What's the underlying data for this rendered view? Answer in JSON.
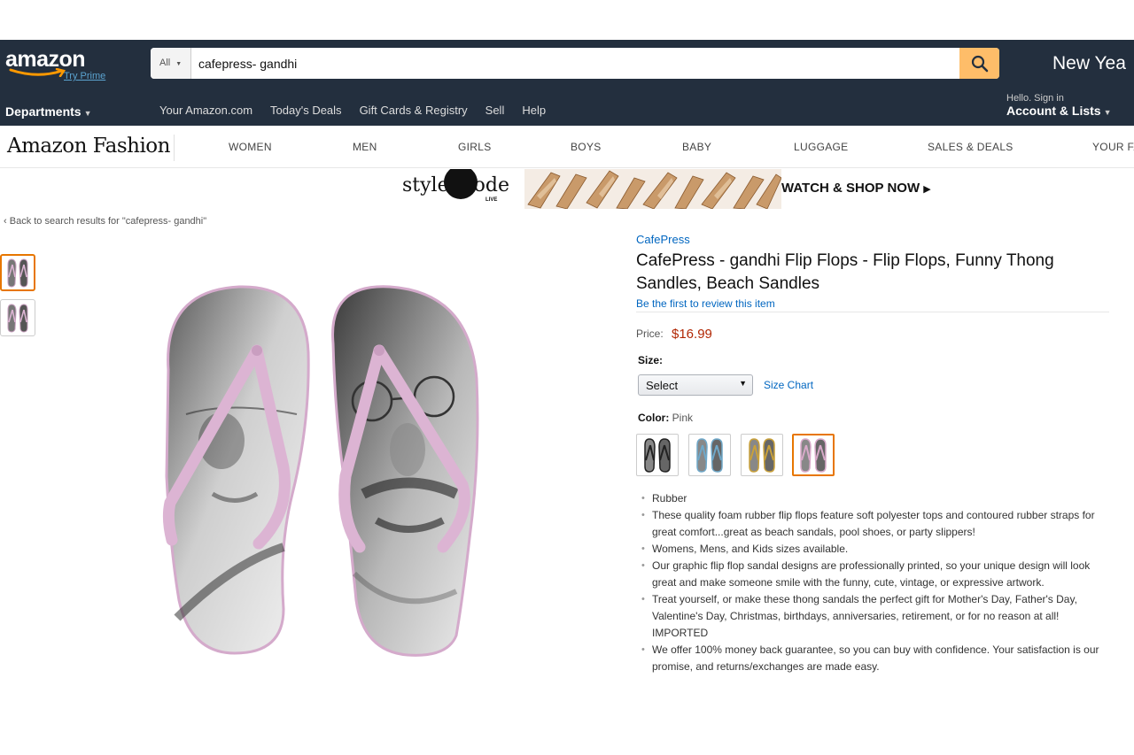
{
  "header": {
    "logo_text": "amazon",
    "logo_prime": "Try Prime",
    "search_scope": "All",
    "search_value": "cafepress- gandhi",
    "promo_text": "New Yea",
    "departments_label": "Departments",
    "nav_links": [
      "Your Amazon.com",
      "Today's Deals",
      "Gift Cards & Registry",
      "Sell",
      "Help"
    ],
    "account_hello": "Hello. Sign in",
    "account_main": "Account & Lists"
  },
  "fashion_nav": {
    "logo": "Amazon Fashion",
    "links": [
      "WOMEN",
      "MEN",
      "GIRLS",
      "BOYS",
      "BABY",
      "LUGGAGE",
      "SALES & DEALS",
      "YOUR FA"
    ]
  },
  "banner": {
    "logo_left": "style",
    "logo_right": "ode",
    "logo_live": "LIVE",
    "cta": "WATCH & SHOP NOW"
  },
  "back_link": "Back to search results for \"cafepress- gandhi\"",
  "product": {
    "brand": "CafePress",
    "title": "CafePress - gandhi Flip Flops - Flip Flops, Funny Thong Sandles, Beach Sandles",
    "review_link": "Be the first to review this item",
    "price_label": "Price:",
    "price": "$16.99",
    "size_label": "Size:",
    "size_selected": "Select",
    "size_chart": "Size Chart",
    "color_label": "Color:",
    "color_value": "Pink",
    "swatches": [
      {
        "color": "#222222",
        "name": "black"
      },
      {
        "color": "#6fa8c9",
        "name": "blue"
      },
      {
        "color": "#c9a13a",
        "name": "gold"
      },
      {
        "color": "#d8a9c9",
        "name": "pink"
      }
    ],
    "strap_color": "#dcb4d3",
    "bullets": [
      "Rubber",
      "These quality foam rubber flip flops feature soft polyester tops and contoured rubber straps for great comfort...great as beach sandals, pool shoes, or party slippers!",
      "Womens, Mens, and Kids sizes available.",
      "Our graphic flip flop sandal designs are professionally printed, so your unique design will look great and make someone smile with the funny, cute, vintage, or expressive artwork.",
      "Treat yourself, or make these thong sandals the perfect gift for Mother's Day, Father's Day, Valentine's Day, Christmas, birthdays, anniversaries, retirement, or for no reason at all! IMPORTED",
      "We offer 100% money back guarantee, so you can buy with confidence. Your satisfaction is our promise, and returns/exchanges are made easy."
    ]
  },
  "colors": {
    "nav_bg": "#232f3e",
    "search_button": "#febd69",
    "link": "#0066c0",
    "price": "#b12704",
    "selected_border": "#e77600"
  }
}
